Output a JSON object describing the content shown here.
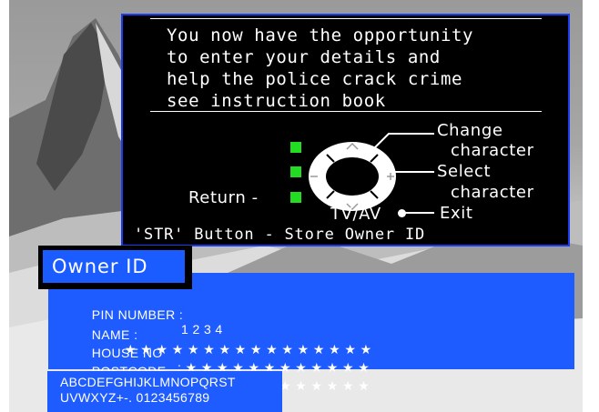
{
  "instructions": {
    "lines": [
      "You now have the opportunity",
      "to enter your details and",
      "help the police crack crime",
      "see instruction book"
    ]
  },
  "controls": {
    "change_line1": "Change",
    "change_line2": "character",
    "select_line1": "Select",
    "select_line2": "character",
    "return_label": "Return -",
    "tvav_label": "TV/AV",
    "exit_label": "Exit",
    "str_button": "'STR' Button - Store Owner ID"
  },
  "owner": {
    "title": "Owner ID",
    "pin_label": "PIN NUMBER :",
    "pin_value": "1 2 3 4",
    "name_label": "NAME :",
    "name_value": "★ ★ ★ ★ ★ ★ ★ ★ ★ ★ ★ ★ ★ ★ ★ ★",
    "house_label": "HOUSE NO",
    "house_value": ": ★ ★ ★ ★ ★ ★ ★ ★ ★ ★ ★ ★",
    "postcode_label": "POSTCODE",
    "postcode_value": ": ★ ★ ★ ★ ★ ★ ★ ★ ★ ★ ★ ★"
  },
  "charset": {
    "line1": "ABCDEFGHIJKLMNOPQRST",
    "line2": "UVWXYZ+-. 0123456789"
  },
  "colors": {
    "panel_bg": "#000000",
    "panel_border": "#1a3cf0",
    "form_bg": "#1f5cff",
    "indicator_green": "#22dd22"
  }
}
